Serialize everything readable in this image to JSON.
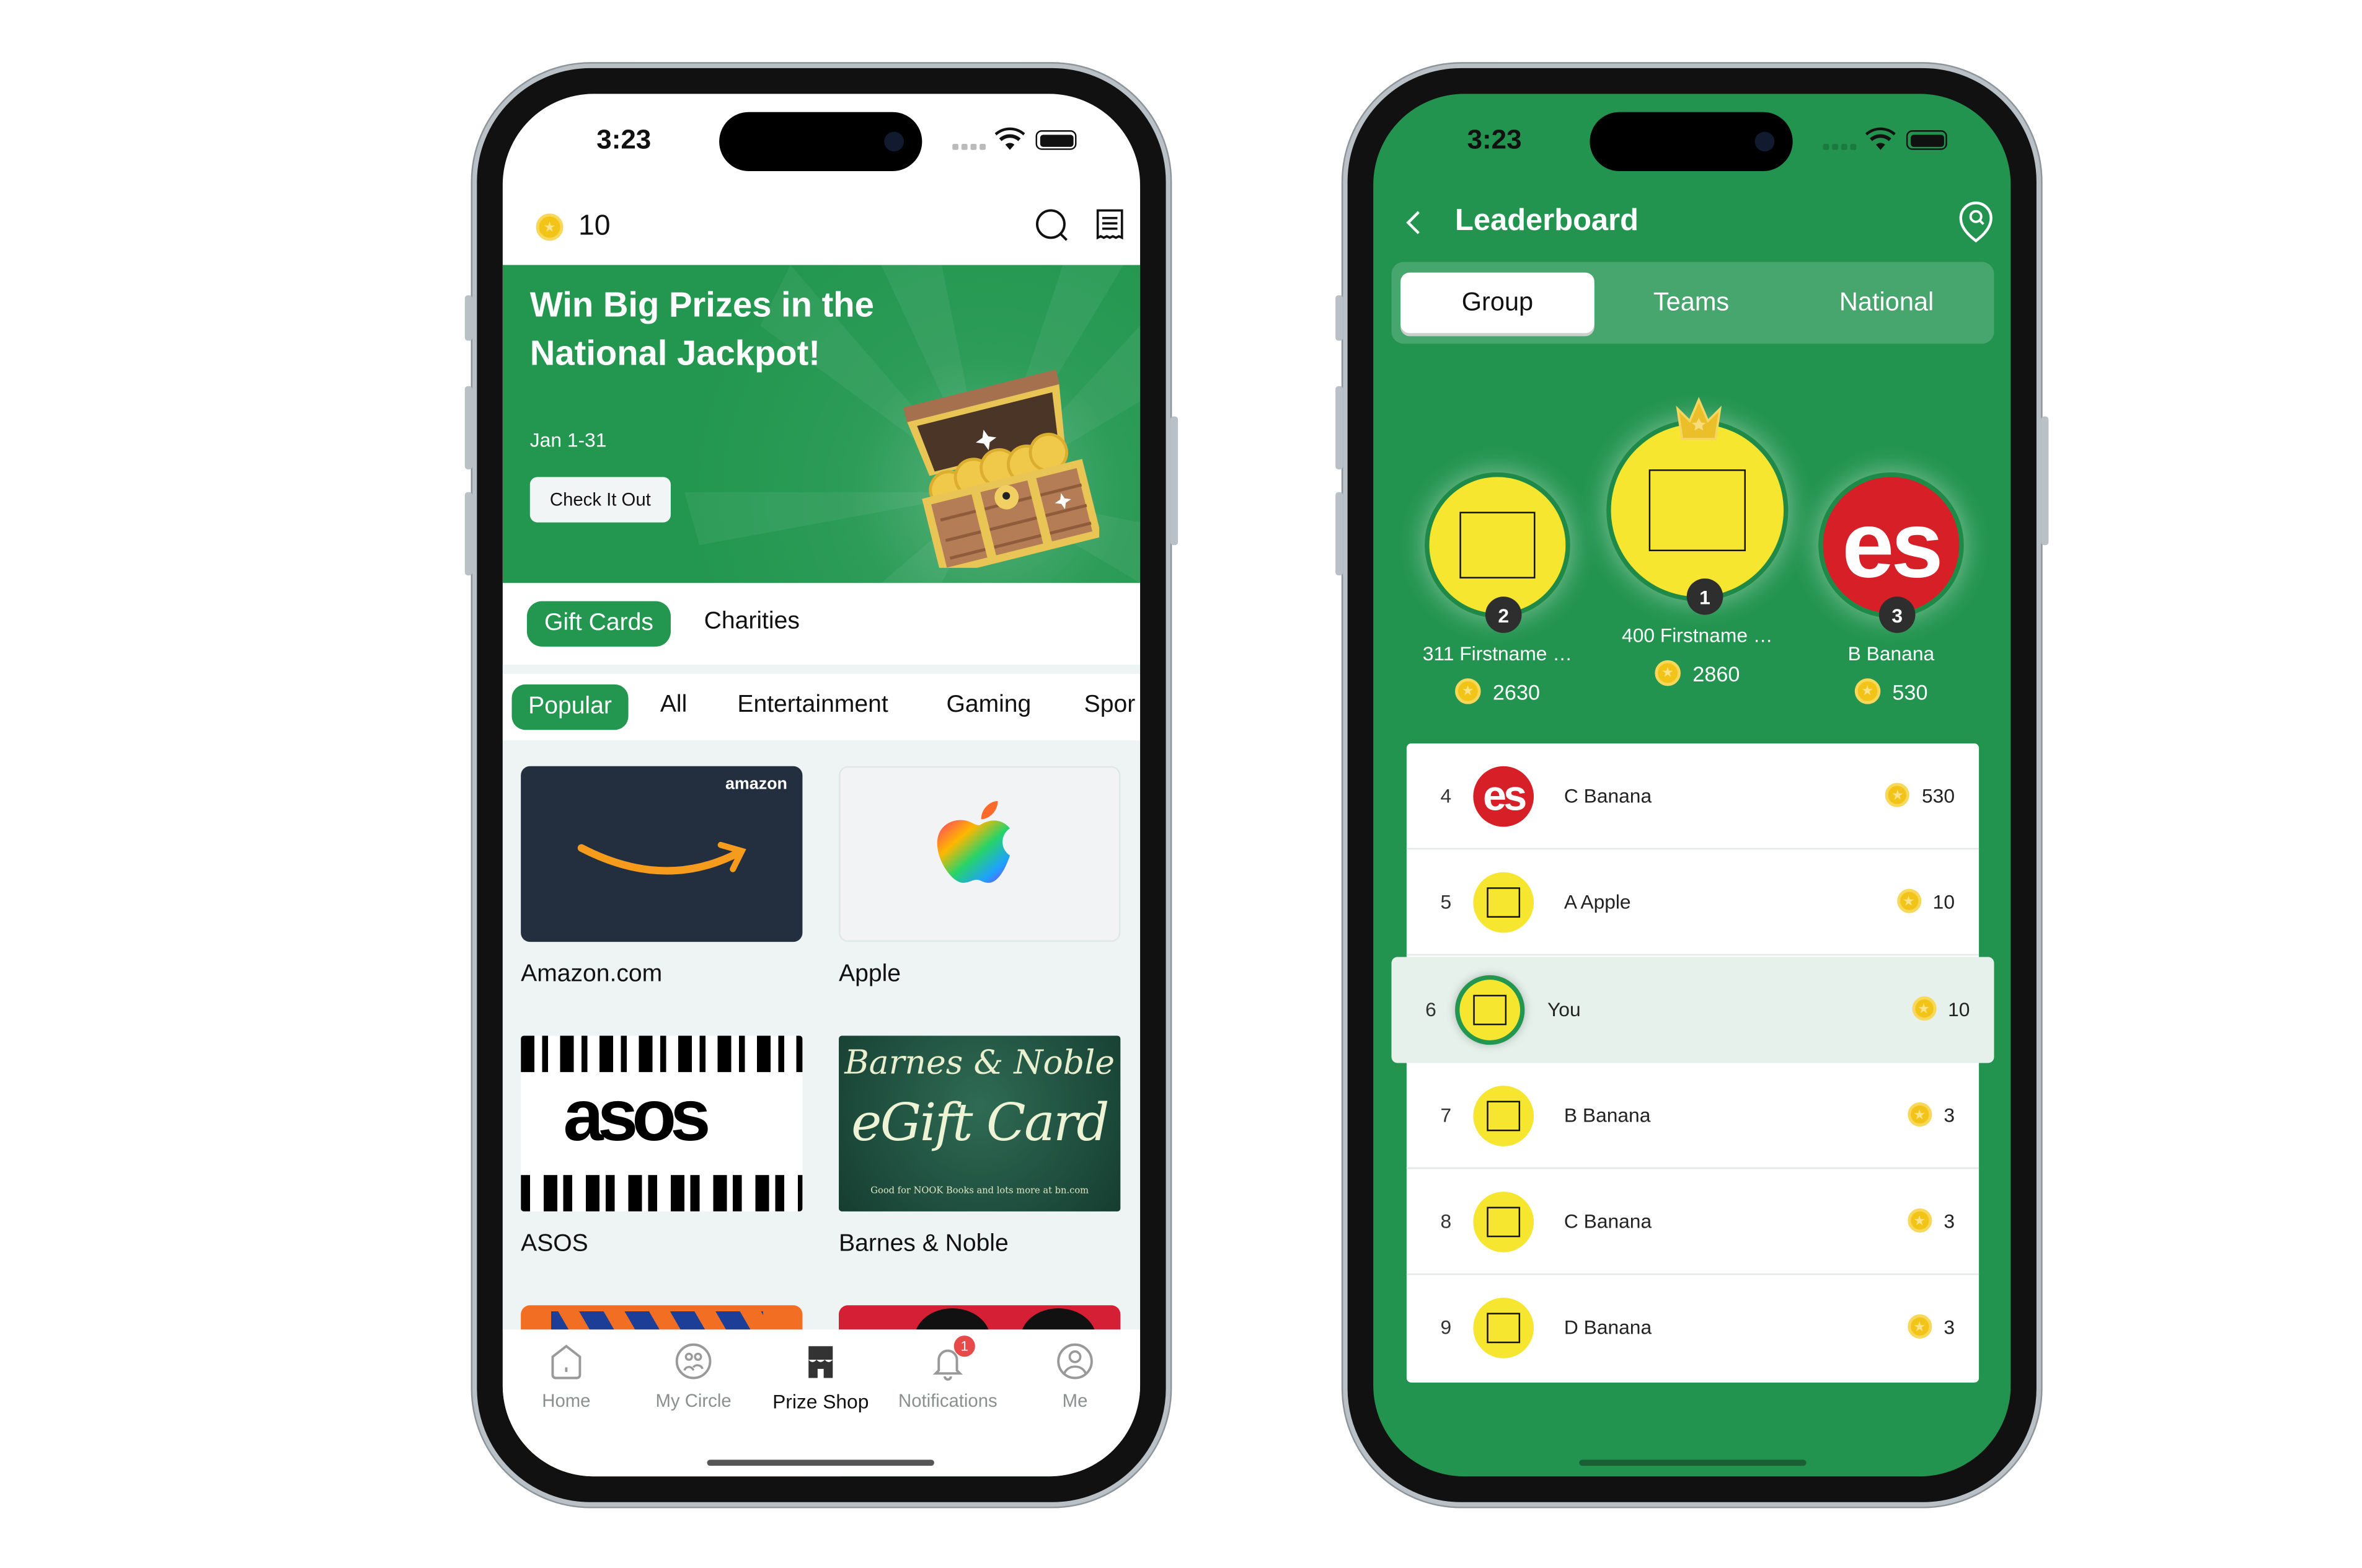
{
  "colors": {
    "brand_green": "#23964f",
    "coin": "#f2c418",
    "badge_red": "#e84a4a"
  },
  "prize_shop": {
    "status": {
      "time": "3:23"
    },
    "header": {
      "coins": "10",
      "icons": [
        "coin-icon",
        "search-icon",
        "receipt-icon"
      ]
    },
    "banner": {
      "title": "Win Big Prizes in the National Jackpot!",
      "date": "Jan 1-31",
      "cta": "Check It Out"
    },
    "category_tabs": [
      {
        "label": "Gift Cards",
        "active": true
      },
      {
        "label": "Charities",
        "active": false
      }
    ],
    "filters": [
      {
        "label": "Popular",
        "active": true
      },
      {
        "label": "All"
      },
      {
        "label": "Entertainment"
      },
      {
        "label": "Gaming"
      },
      {
        "label": "Spor"
      }
    ],
    "cards": [
      {
        "name": "Amazon.com",
        "logo": "amazon"
      },
      {
        "name": "Apple"
      },
      {
        "name": "ASOS",
        "logo": "asos"
      },
      {
        "name": "Barnes & Noble",
        "logo": "Barnes & Noble",
        "subtitle": "eGift Card",
        "fineprint": "Good for NOOK Books and lots more at bn.com"
      }
    ],
    "tabbar": [
      {
        "label": "Home"
      },
      {
        "label": "My Circle"
      },
      {
        "label": "Prize Shop",
        "active": true
      },
      {
        "label": "Notifications",
        "badge": "1"
      },
      {
        "label": "Me"
      }
    ]
  },
  "leaderboard": {
    "status": {
      "time": "3:23"
    },
    "title": "Leaderboard",
    "segments": [
      {
        "label": "Group",
        "selected": true
      },
      {
        "label": "Teams"
      },
      {
        "label": "National"
      }
    ],
    "podium": [
      {
        "rank": "1",
        "name": "400 Firstname …",
        "points": "2860"
      },
      {
        "rank": "2",
        "name": "311 Firstname …",
        "points": "2630"
      },
      {
        "rank": "3",
        "name": "B Banana",
        "points": "530",
        "avatar_text": "es"
      }
    ],
    "rows": [
      {
        "rank": "4",
        "name": "C Banana",
        "points": "530",
        "avatar_text": "es"
      },
      {
        "rank": "5",
        "name": "A Apple",
        "points": "10"
      },
      {
        "rank": "6",
        "name": "You",
        "points": "10",
        "current_user": true
      },
      {
        "rank": "7",
        "name": "B Banana",
        "points": "3"
      },
      {
        "rank": "8",
        "name": "C Banana",
        "points": "3"
      },
      {
        "rank": "9",
        "name": "D Banana",
        "points": "3"
      }
    ]
  }
}
